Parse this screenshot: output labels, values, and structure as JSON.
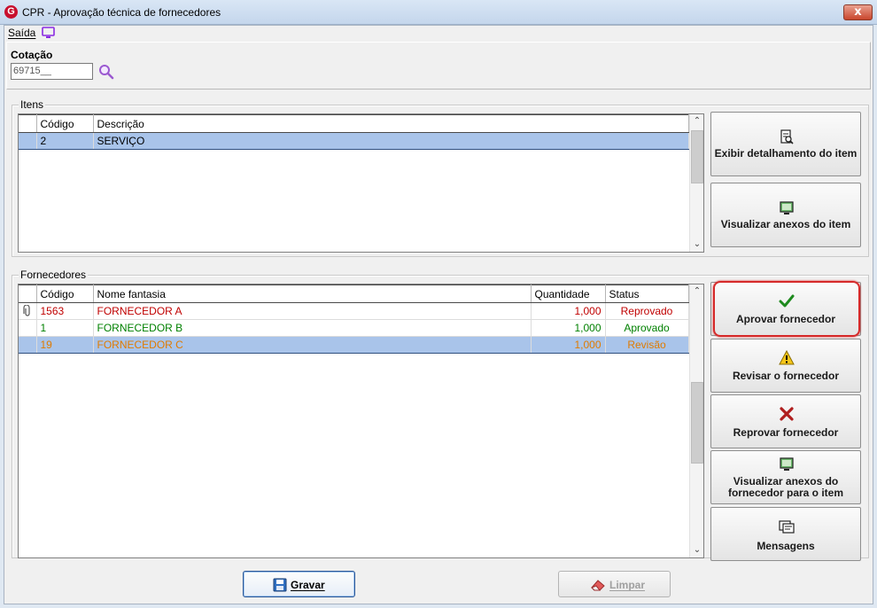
{
  "window": {
    "title": "CPR - Aprovação técnica de fornecedores",
    "logo_letter": "G",
    "close_glyph": "x"
  },
  "menu": {
    "saida": "Saída"
  },
  "cotacao": {
    "label": "Cotação",
    "value": "69715__"
  },
  "itens": {
    "group_title": "Itens",
    "columns": [
      "Código",
      "Descrição"
    ],
    "rows": [
      {
        "codigo": "2",
        "descricao": "SERVIÇO",
        "selected": true
      }
    ]
  },
  "fornecedores": {
    "group_title": "Fornecedores",
    "columns": [
      "Código",
      "Nome fantasia",
      "Quantidade",
      "Status"
    ],
    "rows": [
      {
        "codigo": "1563",
        "nome": "FORNECEDOR A",
        "quantidade": "1,000",
        "status": "Reprovado",
        "color": "#c00000",
        "attachment_icon": "paperclip-icon"
      },
      {
        "codigo": "1",
        "nome": "FORNECEDOR B",
        "quantidade": "1,000",
        "status": "Aprovado",
        "color": "#008000"
      },
      {
        "codigo": "19",
        "nome": "FORNECEDOR C",
        "quantidade": "1,000",
        "status": "Revisão",
        "color": "#e07b00",
        "selected": true
      }
    ]
  },
  "buttons": {
    "exibir_detalhamento": "Exibir detalhamento do item",
    "visualizar_anexos_item": "Visualizar anexos do item",
    "aprovar": "Aprovar fornecedor",
    "revisar": "Revisar o fornecedor",
    "reprovar": "Reprovar fornecedor",
    "visualizar_anexos_fornecedor_1": "Visualizar anexos do",
    "visualizar_anexos_fornecedor_2": "fornecedor para o item",
    "mensagens": "Mensagens",
    "gravar": "Gravar",
    "limpar": "Limpar"
  },
  "colors": {
    "selection": "#a9c4ea",
    "highlight": "#d62a2a",
    "approved": "#008000",
    "rejected": "#c00000",
    "review": "#e07b00"
  }
}
